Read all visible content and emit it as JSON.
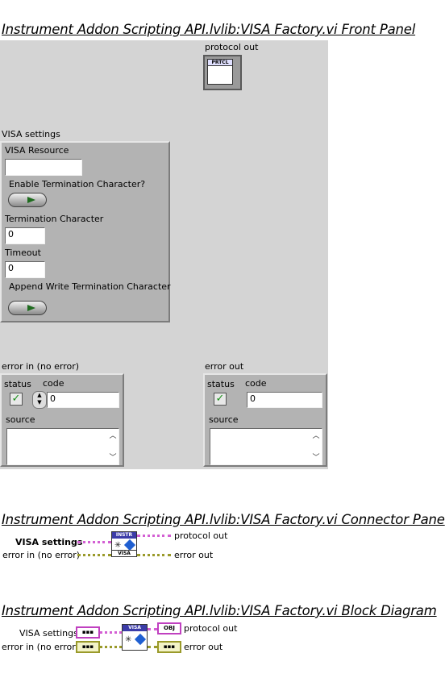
{
  "front_panel": {
    "heading": "Instrument Addon Scripting API.lvlib:VISA Factory.vi Front Panel",
    "protocol_out": {
      "label": "protocol out",
      "icon_text": "PRTCL"
    },
    "visa_settings": {
      "label": "VISA settings",
      "visa_resource_label": "VISA Resource",
      "visa_resource_value": "",
      "enable_term_label": "Enable Termination Character?",
      "term_char_label": "Termination Character",
      "term_char_value": "0",
      "timeout_label": "Timeout",
      "timeout_value": "0",
      "append_write_label": "Append Write Termination Character"
    },
    "error_in": {
      "label": "error in (no error)",
      "status_label": "status",
      "code_label": "code",
      "code_value": "0",
      "source_label": "source",
      "status_mark": "✓"
    },
    "error_out": {
      "label": "error out",
      "status_label": "status",
      "code_label": "code",
      "code_value": "0",
      "source_label": "source",
      "status_mark": "✓"
    }
  },
  "connector_pane": {
    "heading": "Instrument Addon Scripting API.lvlib:VISA Factory.vi Connector Pane",
    "inputs": [
      "VISA settings",
      "error in (no error)"
    ],
    "outputs": [
      "protocol out",
      "error out"
    ],
    "icon_top": "INSTR",
    "icon_bottom": "VISA"
  },
  "block_diagram": {
    "heading": "Instrument Addon Scripting API.lvlib:VISA Factory.vi Block Diagram",
    "inputs": [
      "VISA settings",
      "error in (no error)"
    ],
    "outputs": [
      "protocol out",
      "error out"
    ],
    "node_top": "VISA",
    "obj_terminal": "OBJ"
  },
  "colors": {
    "panel": "#d4d4d4",
    "cluster": "#b3b3b3",
    "wire_pink": "#d35fd3",
    "wire_yellow": "#9a9a2a"
  }
}
